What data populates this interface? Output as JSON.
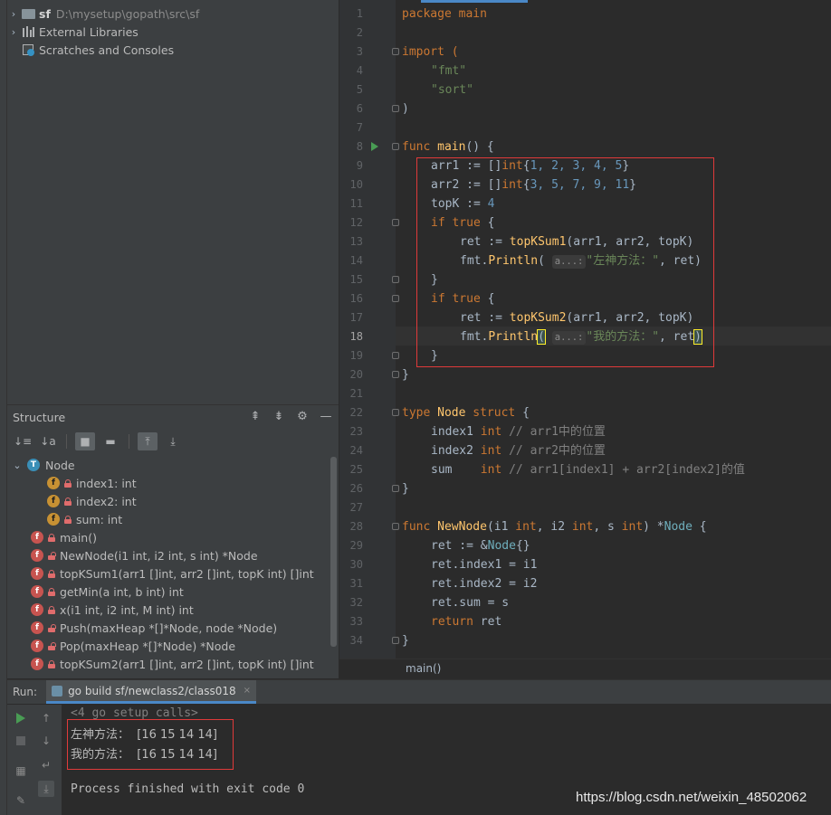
{
  "project": {
    "root_name": "sf",
    "root_path": "D:\\mysetup\\gopath\\src\\sf",
    "external_libraries": "External Libraries",
    "scratches": "Scratches and Consoles"
  },
  "structure": {
    "title": "Structure",
    "items": [
      {
        "label": "Node",
        "kind": "T"
      },
      {
        "label": "index1: int",
        "kind": "f"
      },
      {
        "label": "index2: int",
        "kind": "f"
      },
      {
        "label": "sum: int",
        "kind": "f"
      },
      {
        "label": "main()",
        "kind": "f"
      },
      {
        "label": "NewNode(i1 int, i2 int, s int) *Node",
        "kind": "f"
      },
      {
        "label": "topKSum1(arr1 []int, arr2 []int, topK int) []int",
        "kind": "f"
      },
      {
        "label": "getMin(a int, b int) int",
        "kind": "f"
      },
      {
        "label": "x(i1 int, i2 int, M int) int",
        "kind": "f"
      },
      {
        "label": "Push(maxHeap *[]*Node, node *Node)",
        "kind": "f"
      },
      {
        "label": "Pop(maxHeap *[]*Node) *Node",
        "kind": "f"
      },
      {
        "label": "topKSum2(arr1 []int, arr2 []int, topK int) []int",
        "kind": "f"
      }
    ]
  },
  "editor": {
    "line_numbers": [
      "1",
      "2",
      "3",
      "4",
      "5",
      "6",
      "7",
      "8",
      "9",
      "10",
      "11",
      "12",
      "13",
      "14",
      "15",
      "16",
      "17",
      "18",
      "19",
      "20",
      "21",
      "22",
      "23",
      "24",
      "25",
      "26",
      "27",
      "28",
      "29",
      "30",
      "31",
      "32",
      "33",
      "34"
    ],
    "current_line": "18",
    "hint_label": "a...:",
    "code": {
      "l1": "package main",
      "l3": "import (",
      "l4": "\"fmt\"",
      "l5": "\"sort\"",
      "l6": ")",
      "l8_kw": "func",
      "l8_fn": "main",
      "l8_rest": "() {",
      "l9_a": "arr1 := []",
      "l9_ty": "int",
      "l9_b": "{",
      "l9_nums": "1, 2, 3, 4, 5",
      "l9_c": "}",
      "l10_a": "arr2 := []",
      "l10_nums": "3, 5, 7, 9, 11",
      "l11_a": "topK := ",
      "l11_n": "4",
      "if_kw": "if",
      "true_kw": "true",
      "l12_rest": " {",
      "l13_a": "ret := ",
      "l13_fn": "topKSum1",
      "l13_b": "(arr1, arr2, topK)",
      "pr_a": "fmt.",
      "pr_fn": "Println",
      "l14_str": "\"左神方法：\"",
      "pr_tail": ", ret",
      "close_brace": "}",
      "l17_fn": "topKSum2",
      "l18_str": "\"我的方法：\"",
      "l22_kw": "type",
      "l22_name": "Node",
      "l22_kw2": "struct",
      "l23_a": "index1 ",
      "l23_cm": "// arr1中的位置",
      "l24_a": "index2 ",
      "l24_cm": "// arr2中的位置",
      "l25_a": "sum    ",
      "l25_cm": "// arr1[index1] + arr2[index2]的值",
      "l28_fn": "NewNode",
      "l28_p1": "(i1 ",
      "l28_p2": ", i2 ",
      "l28_p3": ", s ",
      "l28_p4": ") *",
      "l29_a": "ret := &",
      "l29_b": "{}",
      "l30": "ret.index1 = i1",
      "l31": "ret.index2 = i2",
      "l32": "ret.sum = s",
      "l33_kw": "return",
      "l33_b": " ret"
    }
  },
  "breadcrumb": "main()",
  "run": {
    "label": "Run:",
    "tab": "go build sf/newclass2/class018",
    "close": "×",
    "output": [
      "<4 go setup calls>",
      "左神方法：  [16 15 14 14]",
      "我的方法：  [16 15 14 14]",
      "",
      "Process finished with exit code 0"
    ]
  },
  "watermark": "https://blog.csdn.net/weixin_48502062",
  "colors": {
    "keyword": "#cc7832",
    "string": "#6a8759",
    "number": "#6897bb",
    "function": "#ffc66d",
    "type": "#6fafbd",
    "comment": "#808080",
    "highlight_box": "#e03a3a",
    "run_green": "#499c54"
  }
}
